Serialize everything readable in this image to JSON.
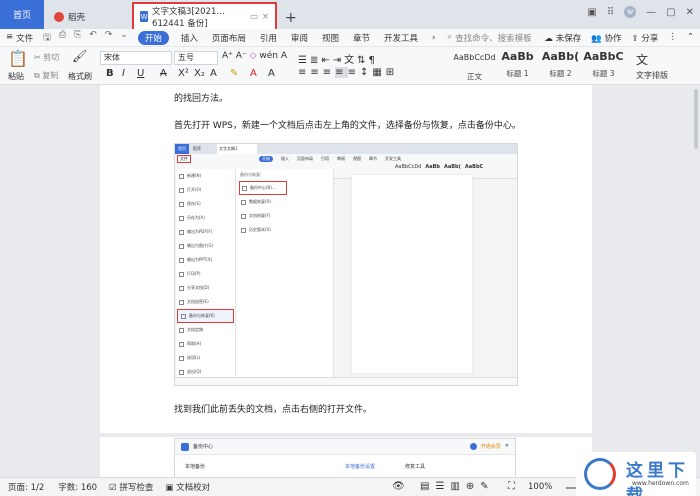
{
  "tabs": {
    "home": "首页",
    "straw": "稻壳",
    "doc": "文字文稿3[2021…612441 备份]",
    "add": "+"
  },
  "window": {
    "avatar": "W"
  },
  "menubar": {
    "file": "文件",
    "start": "开始",
    "items": [
      "插入",
      "页面布局",
      "引用",
      "审阅",
      "视图",
      "章节",
      "开发工具"
    ],
    "search": "查找命令、搜索模板",
    "unsaved": "未保存",
    "collab": "协作",
    "share": "分享"
  },
  "ribbon": {
    "paste": "粘贴",
    "cut": "剪切",
    "copy": "复制",
    "format_painter": "格式刷",
    "font": "宋体",
    "size": "五号",
    "styles": [
      {
        "preview": "AaBbCcDd",
        "name": "正文"
      },
      {
        "preview": "AaBb",
        "name": "标题 1"
      },
      {
        "preview": "AaBb(",
        "name": "标题 2"
      },
      {
        "preview": "AaBbC",
        "name": "标题 3"
      }
    ],
    "text_layout": "文字排版"
  },
  "document": {
    "line1": "的找回方法。",
    "line2": "首先打开 WPS，新建一个文档后点击左上角的文件，选择备份与恢复，点击备份中心。",
    "line3": "找到我们此前丢失的文档，点击右侧的打开文件。"
  },
  "shot1": {
    "home": "首页",
    "straw": "稻壳",
    "doc": "文字文稿1",
    "file": "文件",
    "start": "开始",
    "menu": [
      "插入",
      "页面布局",
      "引用",
      "审阅",
      "视图",
      "章节",
      "开发工具"
    ],
    "styles": [
      "AaBbCcDd",
      "AaBb",
      "AaBb(",
      "AaBbC"
    ],
    "sidebar": [
      "新建(N)",
      "打开(O)",
      "保存(S)",
      "另存为(A)",
      "输出为PDF(F)",
      "输出为图片(G)",
      "输出为PPT(X)",
      "打印(P)",
      "分享文档(D)",
      "文档加密(E)",
      "备份与恢复(K)",
      "文档定稿",
      "帮助(H)",
      "选项(L)",
      "退出(Q)"
    ],
    "submenu_title": "备份与恢复:",
    "submenu": [
      "备份中心(B)...",
      "数据恢复(R)",
      "文档修复(F)",
      "历史版本(V)"
    ]
  },
  "shot2": {
    "title": "备份中心",
    "local": "本地备份",
    "settings": "本地备份设置",
    "repair": "修复工具",
    "vip": "开通会员"
  },
  "statusbar": {
    "page": "页面: 1/2",
    "words": "字数: 160",
    "spell": "拼写检查",
    "proof": "文档校对",
    "zoom": "100%"
  },
  "watermark": {
    "text": "这里下载",
    "url": "www.herdown.com"
  },
  "colors": {
    "accent": "#3b6fd8",
    "highlight": "#e03b3b"
  }
}
